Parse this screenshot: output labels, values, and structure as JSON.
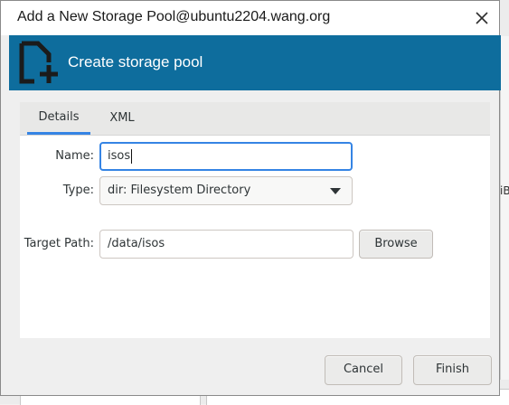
{
  "window": {
    "title": "Add a New Storage Pool@ubuntu2204.wang.org"
  },
  "header": {
    "title": "Create storage pool",
    "icon": "new-storage-icon"
  },
  "tabs": [
    {
      "label": "Details",
      "active": true
    },
    {
      "label": "XML",
      "active": false
    }
  ],
  "form": {
    "name_label": "Name:",
    "name_value": "isos",
    "type_label": "Type:",
    "type_value": "dir: Filesystem Directory",
    "target_path_label": "Target Path:",
    "target_path_value": "/data/isos",
    "browse_label": "Browse"
  },
  "actions": {
    "cancel_label": "Cancel",
    "finish_label": "Finish"
  },
  "background": {
    "edge_text": "iB"
  },
  "colors": {
    "header_bg": "#0e6d9d",
    "focus": "#3584e4"
  }
}
